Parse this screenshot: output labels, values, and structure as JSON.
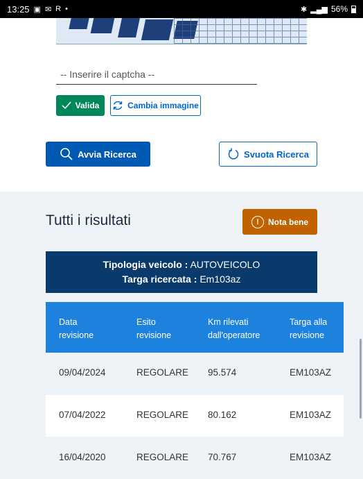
{
  "status_bar": {
    "time": "13:25",
    "left_icons": [
      "gallery-icon",
      "mail-icon",
      "r-icon",
      "dot"
    ],
    "r_label": "R",
    "dot": "•",
    "battery": "56%"
  },
  "captcha": {
    "input_placeholder": "-- Inserire il captcha --",
    "valida_label": "Valida",
    "cambia_label": "Cambia immagine"
  },
  "search": {
    "avvia_label": "Avvia Ricerca",
    "svuota_label": "Svuota Ricerca"
  },
  "results": {
    "title": "Tutti i risultati",
    "nota_label": "Nota bene",
    "vehicle_type_label": "Tipologia veicolo :",
    "vehicle_type_value": "AUTOVEICOLO",
    "plate_label": "Targa ricercata :",
    "plate_value": "Em103az",
    "columns": [
      [
        "Data",
        "revisione"
      ],
      [
        "Esito",
        "revisione"
      ],
      [
        "Km rilevati",
        "dall'operatore"
      ],
      [
        "Targa alla",
        "revisione"
      ]
    ],
    "rows": [
      [
        "09/04/2024",
        "REGOLARE",
        "95.574",
        "EM103AZ"
      ],
      [
        "07/04/2022",
        "REGOLARE",
        "80.162",
        "EM103AZ"
      ],
      [
        "16/04/2020",
        "REGOLARE",
        "70.767",
        "EM103AZ"
      ]
    ]
  },
  "colors": {
    "primary": "#0059b3",
    "success": "#008758",
    "warning": "#c06200",
    "vehicle_box": "#0a3a6b",
    "table_header": "#1c82de"
  }
}
